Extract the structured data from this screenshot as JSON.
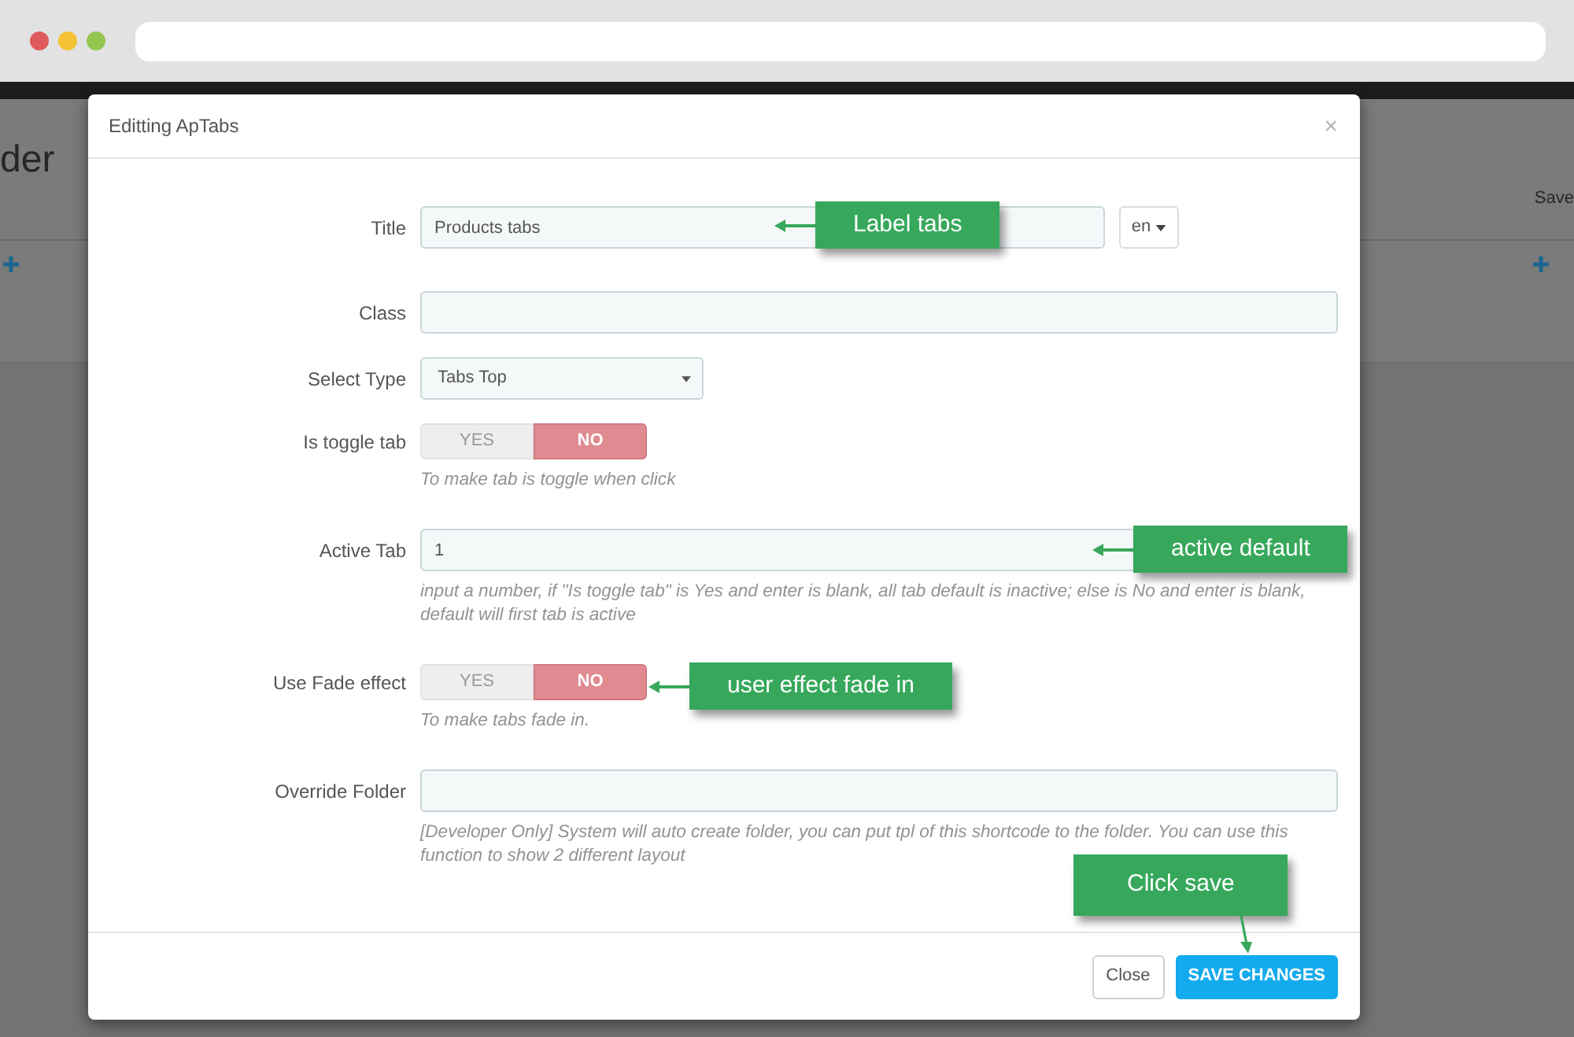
{
  "background_page": {
    "heading": "der",
    "save_label": "Save"
  },
  "dialog": {
    "title": "Editting ApTabs",
    "close_symbol": "×"
  },
  "fields": [
    {
      "label": "Title",
      "kind": "text_lang",
      "value": "Products tabs",
      "language": "en"
    },
    {
      "label": "Class",
      "kind": "text"
    },
    {
      "label": "Select Type",
      "kind": "select",
      "value": "Tabs Top"
    },
    {
      "label": "Is toggle tab",
      "kind": "toggle",
      "options": [
        {
          "label": "YES",
          "selected": false
        },
        {
          "label": "NO",
          "selected": true
        }
      ],
      "help": "To make tab is toggle when click"
    },
    {
      "label": "Active Tab",
      "kind": "text",
      "value": "1",
      "help": "input a number, if \"Is toggle tab\" is Yes and enter is blank, all tab default is inactive; else is No and enter is blank, default will first tab is active"
    },
    {
      "label": "Use Fade effect",
      "kind": "toggle",
      "options": [
        {
          "label": "YES",
          "selected": false
        },
        {
          "label": "NO",
          "selected": true
        }
      ],
      "help": "To make tabs fade in."
    },
    {
      "label": "Override Folder",
      "kind": "text",
      "help": "[Developer Only] System will auto create folder, you can put tpl of this shortcode to the folder. You can use this function to show 2 different layout"
    }
  ],
  "buttons": [
    {
      "label": "Close",
      "kind": "secondary"
    },
    {
      "label": "SAVE CHANGES",
      "kind": "primary"
    }
  ],
  "annotations": [
    {
      "text": "Label tabs",
      "kind": "arrow_left"
    },
    {
      "text": "active default",
      "kind": "arrow_left"
    },
    {
      "text": "user effect fade in",
      "kind": "arrow_left"
    },
    {
      "text": "Click save",
      "kind": "arrow_down"
    }
  ]
}
